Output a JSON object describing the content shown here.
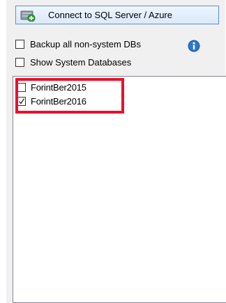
{
  "toolbar": {
    "connect_label": "Connect to SQL Server / Azure",
    "connect_icon": "database-add-icon"
  },
  "options": {
    "backup_all_label": "Backup all non-system DBs",
    "backup_all_checked": false,
    "show_system_label": "Show System Databases",
    "show_system_checked": false,
    "info_icon": "info-icon"
  },
  "databases": [
    {
      "name": "ForintBer2015",
      "checked": false
    },
    {
      "name": "ForintBer2016",
      "checked": true
    }
  ],
  "colors": {
    "highlight": "#e8112d",
    "button_border": "#5b8fd0",
    "info_blue": "#1b5fb3"
  }
}
